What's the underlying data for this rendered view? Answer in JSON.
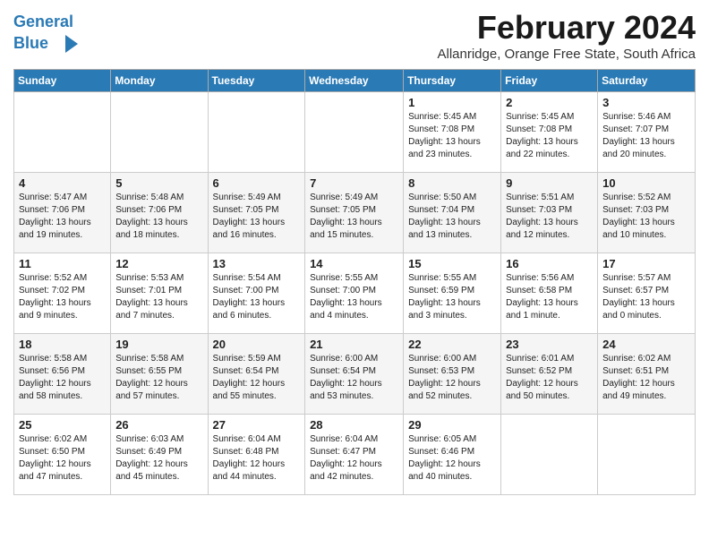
{
  "logo": {
    "line1": "General",
    "line2": "Blue"
  },
  "title": "February 2024",
  "subtitle": "Allanridge, Orange Free State, South Africa",
  "days_of_week": [
    "Sunday",
    "Monday",
    "Tuesday",
    "Wednesday",
    "Thursday",
    "Friday",
    "Saturday"
  ],
  "weeks": [
    [
      {
        "num": "",
        "info": ""
      },
      {
        "num": "",
        "info": ""
      },
      {
        "num": "",
        "info": ""
      },
      {
        "num": "",
        "info": ""
      },
      {
        "num": "1",
        "info": "Sunrise: 5:45 AM\nSunset: 7:08 PM\nDaylight: 13 hours\nand 23 minutes."
      },
      {
        "num": "2",
        "info": "Sunrise: 5:45 AM\nSunset: 7:08 PM\nDaylight: 13 hours\nand 22 minutes."
      },
      {
        "num": "3",
        "info": "Sunrise: 5:46 AM\nSunset: 7:07 PM\nDaylight: 13 hours\nand 20 minutes."
      }
    ],
    [
      {
        "num": "4",
        "info": "Sunrise: 5:47 AM\nSunset: 7:06 PM\nDaylight: 13 hours\nand 19 minutes."
      },
      {
        "num": "5",
        "info": "Sunrise: 5:48 AM\nSunset: 7:06 PM\nDaylight: 13 hours\nand 18 minutes."
      },
      {
        "num": "6",
        "info": "Sunrise: 5:49 AM\nSunset: 7:05 PM\nDaylight: 13 hours\nand 16 minutes."
      },
      {
        "num": "7",
        "info": "Sunrise: 5:49 AM\nSunset: 7:05 PM\nDaylight: 13 hours\nand 15 minutes."
      },
      {
        "num": "8",
        "info": "Sunrise: 5:50 AM\nSunset: 7:04 PM\nDaylight: 13 hours\nand 13 minutes."
      },
      {
        "num": "9",
        "info": "Sunrise: 5:51 AM\nSunset: 7:03 PM\nDaylight: 13 hours\nand 12 minutes."
      },
      {
        "num": "10",
        "info": "Sunrise: 5:52 AM\nSunset: 7:03 PM\nDaylight: 13 hours\nand 10 minutes."
      }
    ],
    [
      {
        "num": "11",
        "info": "Sunrise: 5:52 AM\nSunset: 7:02 PM\nDaylight: 13 hours\nand 9 minutes."
      },
      {
        "num": "12",
        "info": "Sunrise: 5:53 AM\nSunset: 7:01 PM\nDaylight: 13 hours\nand 7 minutes."
      },
      {
        "num": "13",
        "info": "Sunrise: 5:54 AM\nSunset: 7:00 PM\nDaylight: 13 hours\nand 6 minutes."
      },
      {
        "num": "14",
        "info": "Sunrise: 5:55 AM\nSunset: 7:00 PM\nDaylight: 13 hours\nand 4 minutes."
      },
      {
        "num": "15",
        "info": "Sunrise: 5:55 AM\nSunset: 6:59 PM\nDaylight: 13 hours\nand 3 minutes."
      },
      {
        "num": "16",
        "info": "Sunrise: 5:56 AM\nSunset: 6:58 PM\nDaylight: 13 hours\nand 1 minute."
      },
      {
        "num": "17",
        "info": "Sunrise: 5:57 AM\nSunset: 6:57 PM\nDaylight: 13 hours\nand 0 minutes."
      }
    ],
    [
      {
        "num": "18",
        "info": "Sunrise: 5:58 AM\nSunset: 6:56 PM\nDaylight: 12 hours\nand 58 minutes."
      },
      {
        "num": "19",
        "info": "Sunrise: 5:58 AM\nSunset: 6:55 PM\nDaylight: 12 hours\nand 57 minutes."
      },
      {
        "num": "20",
        "info": "Sunrise: 5:59 AM\nSunset: 6:54 PM\nDaylight: 12 hours\nand 55 minutes."
      },
      {
        "num": "21",
        "info": "Sunrise: 6:00 AM\nSunset: 6:54 PM\nDaylight: 12 hours\nand 53 minutes."
      },
      {
        "num": "22",
        "info": "Sunrise: 6:00 AM\nSunset: 6:53 PM\nDaylight: 12 hours\nand 52 minutes."
      },
      {
        "num": "23",
        "info": "Sunrise: 6:01 AM\nSunset: 6:52 PM\nDaylight: 12 hours\nand 50 minutes."
      },
      {
        "num": "24",
        "info": "Sunrise: 6:02 AM\nSunset: 6:51 PM\nDaylight: 12 hours\nand 49 minutes."
      }
    ],
    [
      {
        "num": "25",
        "info": "Sunrise: 6:02 AM\nSunset: 6:50 PM\nDaylight: 12 hours\nand 47 minutes."
      },
      {
        "num": "26",
        "info": "Sunrise: 6:03 AM\nSunset: 6:49 PM\nDaylight: 12 hours\nand 45 minutes."
      },
      {
        "num": "27",
        "info": "Sunrise: 6:04 AM\nSunset: 6:48 PM\nDaylight: 12 hours\nand 44 minutes."
      },
      {
        "num": "28",
        "info": "Sunrise: 6:04 AM\nSunset: 6:47 PM\nDaylight: 12 hours\nand 42 minutes."
      },
      {
        "num": "29",
        "info": "Sunrise: 6:05 AM\nSunset: 6:46 PM\nDaylight: 12 hours\nand 40 minutes."
      },
      {
        "num": "",
        "info": ""
      },
      {
        "num": "",
        "info": ""
      }
    ]
  ]
}
